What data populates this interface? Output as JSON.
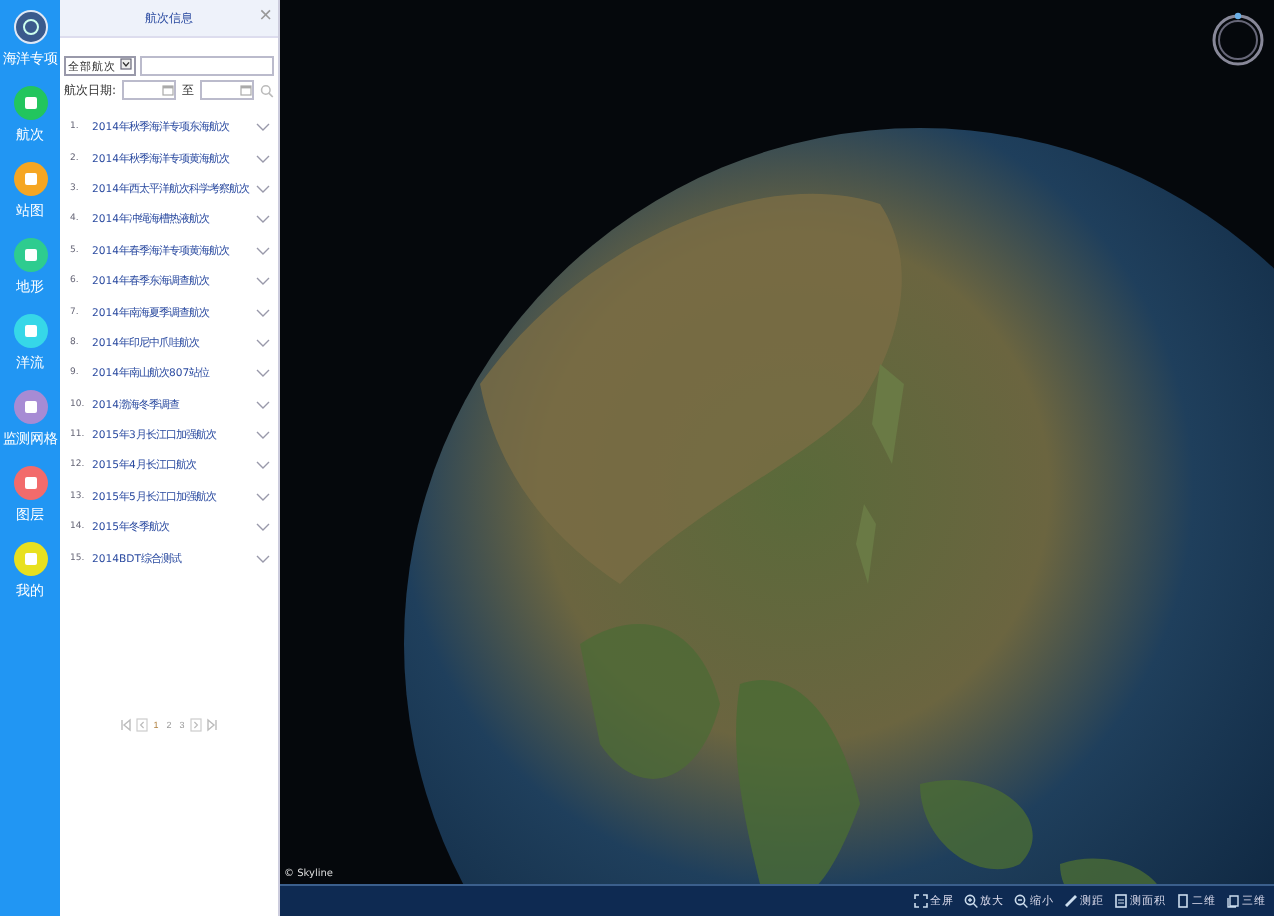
{
  "sidebar": {
    "items": [
      {
        "kind": "logo",
        "label": "海洋专项",
        "color": "#3a5a8c"
      },
      {
        "kind": "nav",
        "label": "航次",
        "color": "#22c55e"
      },
      {
        "kind": "nav",
        "label": "站图",
        "color": "#f5a623"
      },
      {
        "kind": "nav",
        "label": "地形",
        "color": "#2ecc8f"
      },
      {
        "kind": "nav",
        "label": "洋流",
        "color": "#36d7e8"
      },
      {
        "kind": "nav",
        "label": "监测网格",
        "color": "#a78bd4"
      },
      {
        "kind": "nav",
        "label": "图层",
        "color": "#f26b6b"
      },
      {
        "kind": "nav",
        "label": "我的",
        "color": "#e8e01f"
      }
    ]
  },
  "panel": {
    "title": "航次信息",
    "close": "×",
    "filter": {
      "value": "全部航次",
      "date_label": "航次日期:",
      "to_label": "至"
    },
    "voyages": [
      {
        "number": "1.",
        "name": "2014年秋季海洋专项东海航次"
      },
      {
        "number": "2.",
        "name": "2014年秋季海洋专项黄海航次"
      },
      {
        "number": "3.",
        "name": "2014年西太平洋航次科学考察航次"
      },
      {
        "number": "4.",
        "name": "2014年冲绳海槽热液航次"
      },
      {
        "number": "5.",
        "name": "2014年春季海洋专项黄海航次"
      },
      {
        "number": "6.",
        "name": "2014年春季东海调查航次"
      },
      {
        "number": "7.",
        "name": "2014年南海夏季调查航次"
      },
      {
        "number": "8.",
        "name": "2014年印尼中爪哇航次"
      },
      {
        "number": "9.",
        "name": "2014年南山航次807站位"
      },
      {
        "number": "10.",
        "name": "2014渤海冬季调查"
      },
      {
        "number": "11.",
        "name": "2015年3月长江口加强航次"
      },
      {
        "number": "12.",
        "name": "2015年4月长江口航次"
      },
      {
        "number": "13.",
        "name": "2015年5月长江口加强航次"
      },
      {
        "number": "14.",
        "name": "2015年冬季航次"
      },
      {
        "number": "15.",
        "name": "2014BDT综合测试"
      }
    ],
    "pages": [
      {
        "label": "1",
        "selected": true
      },
      {
        "label": "2",
        "selected": false
      },
      {
        "label": "3",
        "selected": false
      }
    ]
  },
  "map": {
    "credit": "© Skyline",
    "toolbar": [
      {
        "kind": "fullscreen",
        "label": "全屏"
      },
      {
        "kind": "zoom-in",
        "label": "放大"
      },
      {
        "kind": "zoom-out",
        "label": "缩小"
      },
      {
        "kind": "measure",
        "label": "测距"
      },
      {
        "kind": "area",
        "label": "测面积"
      },
      {
        "kind": "flat",
        "label": "二维"
      },
      {
        "kind": "globe",
        "label": "三维"
      }
    ]
  }
}
